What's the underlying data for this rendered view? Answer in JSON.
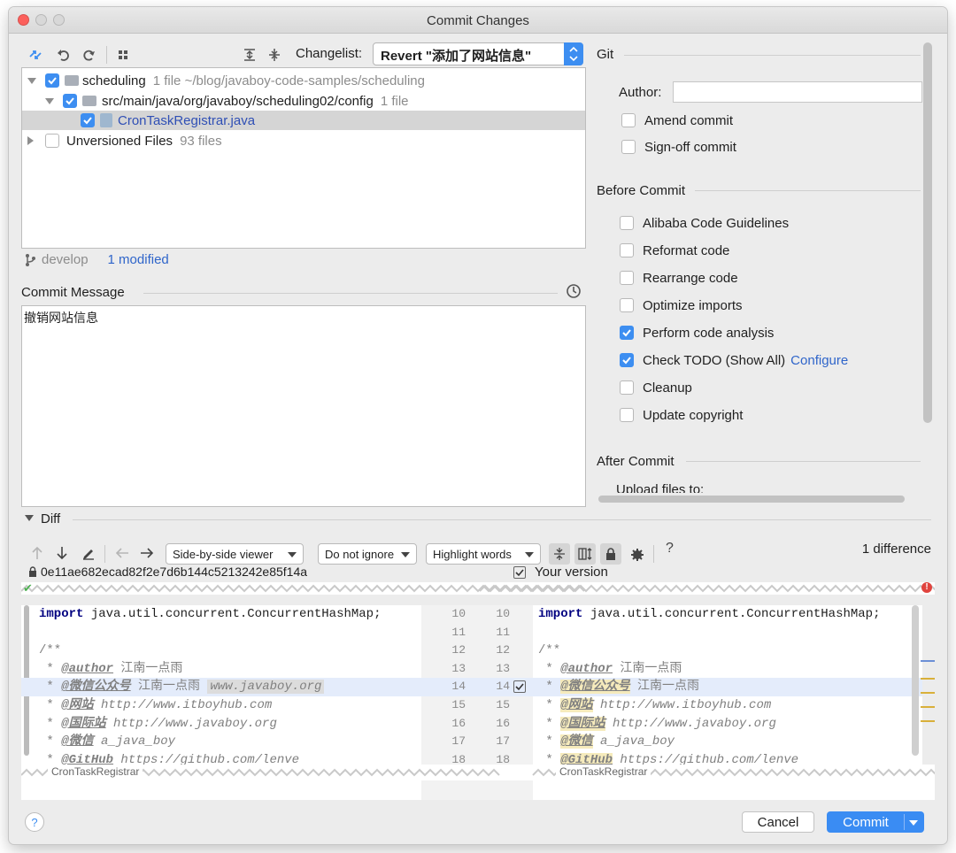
{
  "window": {
    "title": "Commit Changes"
  },
  "changelist": {
    "label": "Changelist:",
    "value": "Revert \"添加了网站信息\""
  },
  "tree": {
    "root": {
      "name": "scheduling",
      "meta": "1 file  ~/blog/javaboy-code-samples/scheduling"
    },
    "folder": {
      "name": "src/main/java/org/javaboy/scheduling02/config",
      "meta": "1 file"
    },
    "file": {
      "name": "CronTaskRegistrar.java"
    },
    "unversioned": {
      "name": "Unversioned Files",
      "meta": "93 files"
    }
  },
  "status": {
    "branch": "develop",
    "modified": "1 modified"
  },
  "commit_message": {
    "label": "Commit Message",
    "text": "撤销网站信息"
  },
  "git": {
    "section": "Git",
    "author_label": "Author:",
    "author_value": "",
    "amend": "Amend commit",
    "signoff": "Sign-off commit"
  },
  "before_commit": {
    "section": "Before Commit",
    "items": [
      {
        "label": "Alibaba Code Guidelines",
        "checked": false
      },
      {
        "label": "Reformat code",
        "checked": false
      },
      {
        "label": "Rearrange code",
        "checked": false
      },
      {
        "label": "Optimize imports",
        "checked": false
      },
      {
        "label": "Perform code analysis",
        "checked": true
      },
      {
        "label": "Check TODO (Show All)",
        "checked": true,
        "link": "Configure"
      },
      {
        "label": "Cleanup",
        "checked": false
      },
      {
        "label": "Update copyright",
        "checked": false
      }
    ]
  },
  "after_commit": {
    "section": "After Commit",
    "upload": "Upload files to:"
  },
  "diff": {
    "label": "Diff",
    "viewer": "Side-by-side viewer",
    "ignore": "Do not ignore",
    "highlight": "Highlight words",
    "count": "1 difference",
    "left_hash": "0e11ae682ecad82f2e7d6b144c5213242e85f14a",
    "right_label": "Your version",
    "left_class": "CronTaskRegistrar",
    "right_class": "CronTaskRegistrar",
    "line_numbers": [
      10,
      11,
      12,
      13,
      14,
      15,
      16,
      17,
      18
    ],
    "import_kw": "import",
    "import_rest": " java.util.concurrent.ConcurrentHashMap;",
    "c_open": "/**",
    "c_star": " * ",
    "tag_author": "@author",
    "author_name": " 江南一点雨",
    "tag_wechat": "@微信公众号",
    "wechat_name": " 江南一点雨",
    "wechat_url": "www.javaboy.org",
    "tag_site": "@网站",
    "site_url": " http://www.itboyhub.com",
    "tag_intl": "@国际站",
    "intl_url": " http://www.javaboy.org",
    "tag_wx": "@微信",
    "wx_id": " a_java_boy",
    "tag_gh": "@GitHub",
    "gh_url": " https://github.com/lenve"
  },
  "buttons": {
    "help": "?",
    "cancel": "Cancel",
    "commit": "Commit"
  },
  "colors": {
    "accent": "#3d8ef1",
    "commit_button": "#3a8cf3",
    "link": "#2f65ca"
  }
}
